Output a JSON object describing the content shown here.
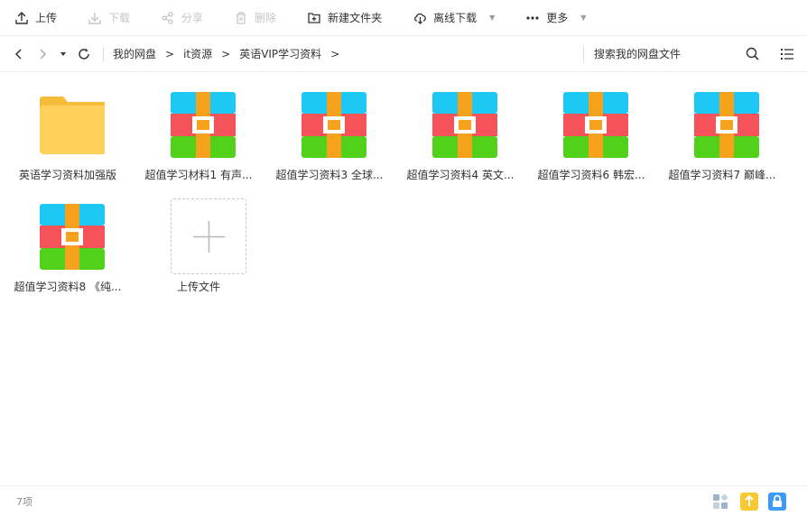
{
  "toolbar": {
    "upload": "上传",
    "download": "下载",
    "share": "分享",
    "delete": "删除",
    "new_folder": "新建文件夹",
    "offline_download": "离线下载",
    "more": "更多"
  },
  "nav": {
    "crumbs": [
      "我的网盘",
      "it资源",
      "英语VIP学习资料"
    ],
    "search_placeholder": "搜索我的网盘文件"
  },
  "files": [
    {
      "name": "英语学习资料加强版",
      "type": "folder"
    },
    {
      "name": "超值学习材料1 有声...",
      "type": "archive"
    },
    {
      "name": "超值学习资料3 全球...",
      "type": "archive"
    },
    {
      "name": "超值学习资料4 英文...",
      "type": "archive"
    },
    {
      "name": "超值学习资料6 韩宏...",
      "type": "archive"
    },
    {
      "name": "超值学习资料7 巅峰...",
      "type": "archive"
    },
    {
      "name": "超值学习资料8 《纯...",
      "type": "archive"
    }
  ],
  "upload_tile": "上传文件",
  "status": {
    "count": "7项"
  },
  "colors": {
    "folder": "#ffd05b",
    "folder_tab": "#f5bd3a",
    "archive_cyan": "#1ec8f5",
    "archive_red": "#f5525a",
    "archive_green": "#52d11a",
    "archive_strap": "#f7a21c",
    "status_upload": "#f8c933",
    "status_lock": "#3d9af6"
  }
}
